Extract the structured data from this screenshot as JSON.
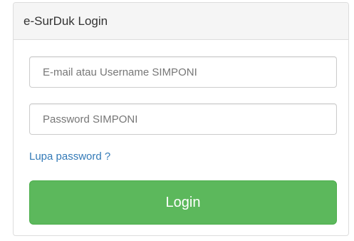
{
  "panel": {
    "title": "e-SurDuk Login"
  },
  "form": {
    "email_placeholder": "E-mail atau Username SIMPONI",
    "email_value": "",
    "password_placeholder": "Password SIMPONI",
    "password_value": "",
    "forgot_label": "Lupa password ?",
    "login_label": "Login"
  },
  "colors": {
    "login_button": "#5cb85c",
    "link": "#337ab7",
    "heading_bg": "#f5f5f5",
    "border": "#dddddd"
  }
}
